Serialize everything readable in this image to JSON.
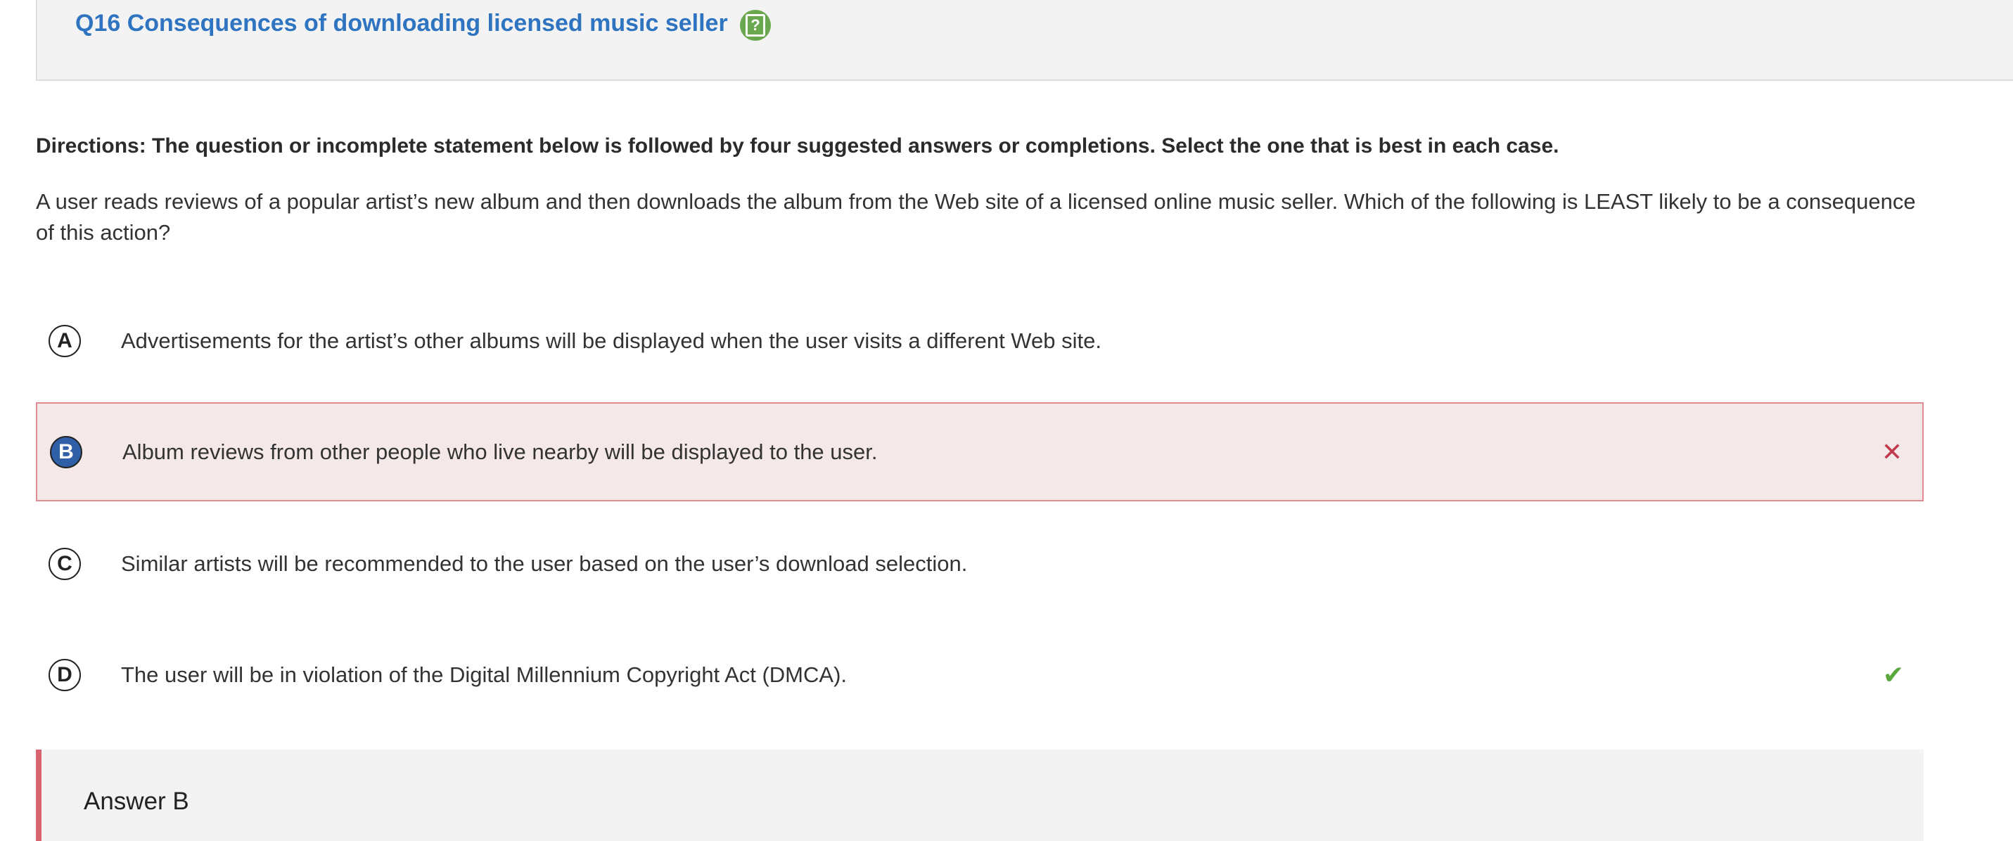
{
  "header": {
    "question_title": "Q16 Consequences of downloading licensed music seller",
    "help_icon": "help-clipboard-icon"
  },
  "directions": "Directions: The question or incomplete statement below is followed by four suggested answers or completions. Select the one that is best in each case.",
  "stem": "A user reads reviews of a popular artist’s new album and then downloads the album from the Web site of a licensed online music seller. Which of the following is LEAST likely to be a consequence of this action?",
  "choices": [
    {
      "letter": "A",
      "text": "Advertisements for the artist’s other albums will be displayed when the user visits a different Web site."
    },
    {
      "letter": "B",
      "text": "Album reviews from other people who live nearby will be displayed to the user.",
      "status": "selected-incorrect",
      "mark": "✕"
    },
    {
      "letter": "C",
      "text": "Similar artists will be recommended to the user based on the user’s download selection."
    },
    {
      "letter": "D",
      "text": "The user will be in violation of the Digital Millennium Copyright Act (DMCA).",
      "status": "correct",
      "mark": "✔"
    }
  ],
  "answer": {
    "label": "Answer B"
  },
  "colors": {
    "title_blue": "#2f74c0",
    "help_green": "#6aa84f",
    "wrong_red": "#c0394b",
    "wrong_bg": "#f5e8e8",
    "right_green": "#5aa83e",
    "selected_letter_bg": "#2e5fa7",
    "answer_accent": "#d9646f"
  }
}
